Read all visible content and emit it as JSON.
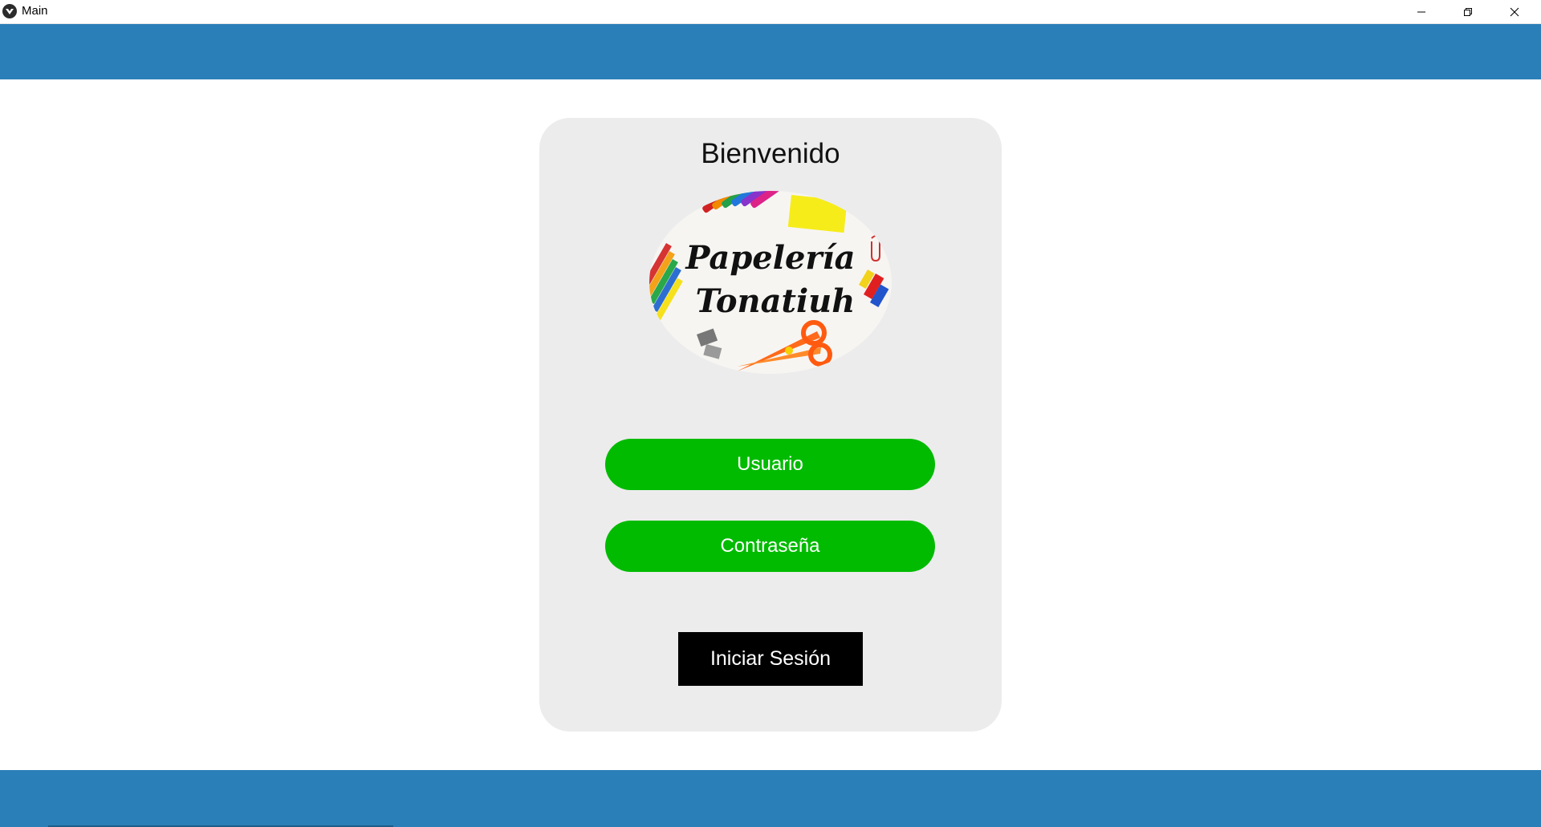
{
  "window": {
    "title": "Main",
    "app_icon": "kivy-icon",
    "controls": [
      "minimize-icon",
      "restore-icon",
      "close-icon"
    ]
  },
  "colors": {
    "band": "#2b7fb8",
    "card": "#ececec",
    "pill": "#00bb00",
    "button": "#000000"
  },
  "login": {
    "heading": "Bienvenido",
    "logo": {
      "line1": "Papelería",
      "line2": "Tonatiuh"
    },
    "username_label": "Usuario",
    "password_label": "Contraseña",
    "submit_label": "Iniciar Sesión"
  }
}
